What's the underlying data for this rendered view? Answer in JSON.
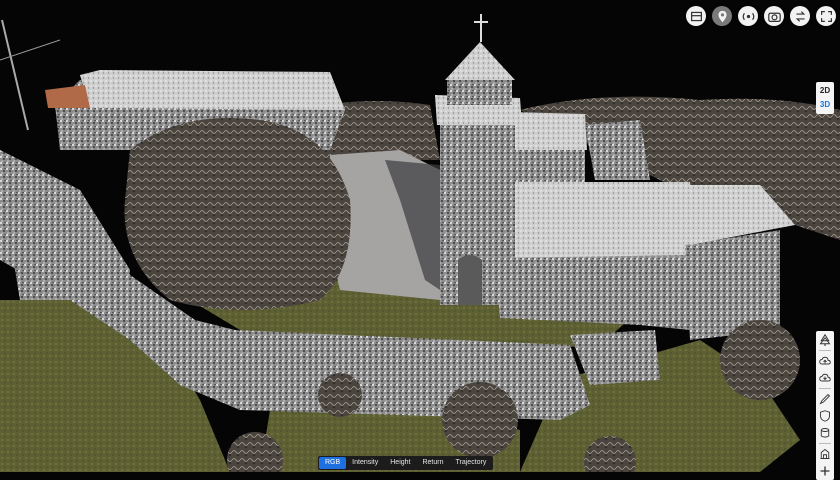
{
  "toolbar": {
    "buttons": [
      {
        "icon": "layers-icon",
        "active": false
      },
      {
        "icon": "location-pin-icon",
        "active": true
      },
      {
        "icon": "broadcast-icon",
        "active": false
      },
      {
        "icon": "camera-icon",
        "active": false
      },
      {
        "icon": "swap-icon",
        "active": false
      },
      {
        "icon": "fullscreen-icon",
        "active": false
      }
    ]
  },
  "view_toggle": {
    "option_2d": "2D",
    "option_3d": "3D",
    "active": "3D"
  },
  "side_tools": [
    "tree-icon",
    "cloud-up-icon",
    "cloud-down-icon",
    "draw-icon",
    "shield-icon",
    "cylinder-icon",
    "building-icon",
    "plus-icon"
  ],
  "mode_bar": {
    "options": [
      "RGB",
      "Intensity",
      "Height",
      "Return",
      "Trajectory"
    ],
    "active": "RGB"
  },
  "colors": {
    "accent": "#1e6fe0",
    "panel": "#f4f4f4",
    "bar": "#1c1c1c"
  }
}
